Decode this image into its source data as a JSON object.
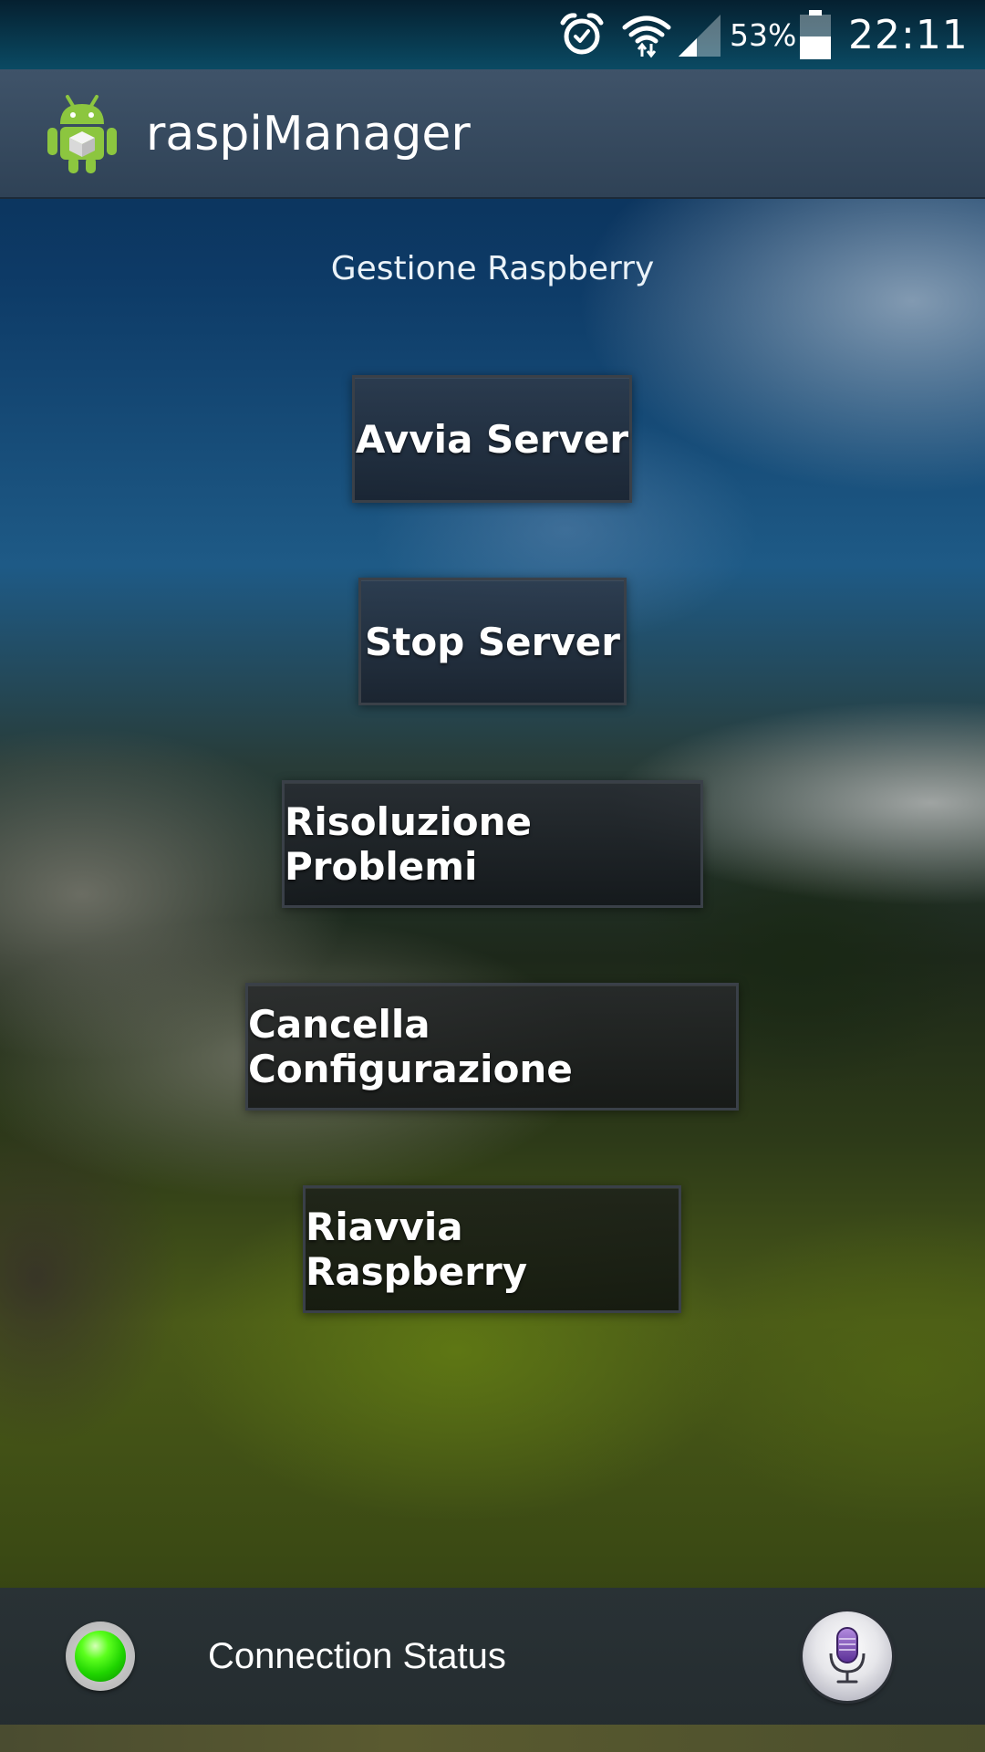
{
  "status_bar": {
    "battery_percent": "53%",
    "time": "22:11",
    "icons": [
      "alarm-icon",
      "wifi-icon",
      "signal-icon",
      "battery-icon"
    ]
  },
  "action_bar": {
    "app_icon": "android-icon",
    "title": "raspiManager"
  },
  "main": {
    "heading": "Gestione Raspberry",
    "buttons": [
      {
        "label": "Avvia Server"
      },
      {
        "label": "Stop Server"
      },
      {
        "label": "Risoluzione Problemi"
      },
      {
        "label": "Cancella Configurazione"
      },
      {
        "label": "Riavvia Raspberry"
      }
    ]
  },
  "bottom_bar": {
    "status_indicator_color": "#2bd400",
    "connection_label": "Connection Status",
    "voice_icon": "microphone-icon"
  }
}
